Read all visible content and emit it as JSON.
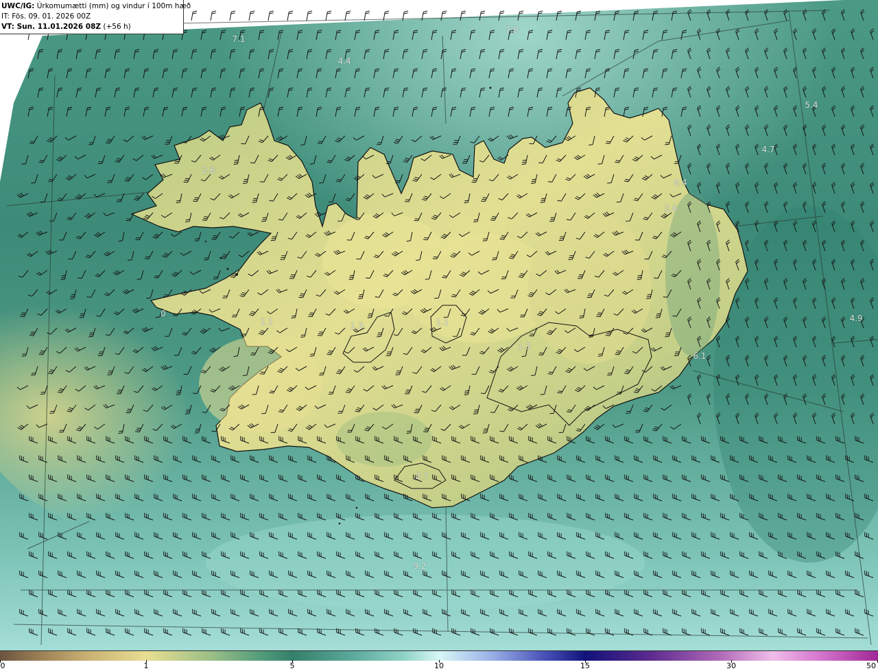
{
  "header": {
    "product": "UWC/IG:",
    "title": "Úrkomumætti (mm) og vindur í 100m hæð",
    "initial_time": "IT: Fös. 09. 01. 2026 00Z",
    "valid_prefix": "VT: Sun. 11.01.2026 08Z",
    "valid_suffix": "(+56 h)"
  },
  "value_labels": [
    "7.1",
    "7.8",
    "4.4",
    "5.4",
    "4.7",
    "2.6",
    "6.4",
    "2.6",
    "4.9",
    "6.1",
    "0",
    "1.1",
    "1.3",
    "1.1",
    "1.3",
    "2.7",
    "9.2"
  ],
  "colorbar": {
    "tick_labels": [
      "0",
      "1",
      "5",
      "10",
      "15",
      "30",
      "50"
    ],
    "colors": {
      "low": "#6b5440",
      "one": "#e8de92",
      "five": "#35806a",
      "ten": "#d7f7f6",
      "fifteen": "#11137a",
      "thirty": "#f0bde8",
      "fifty": "#a02796"
    }
  },
  "legend_colors": {
    "ocean_base": "#3d8a78",
    "ocean_light": "#8fd3c8",
    "land_dry": "#e6e08f",
    "land_mid": "#a8c47e",
    "coast": "#111111"
  }
}
